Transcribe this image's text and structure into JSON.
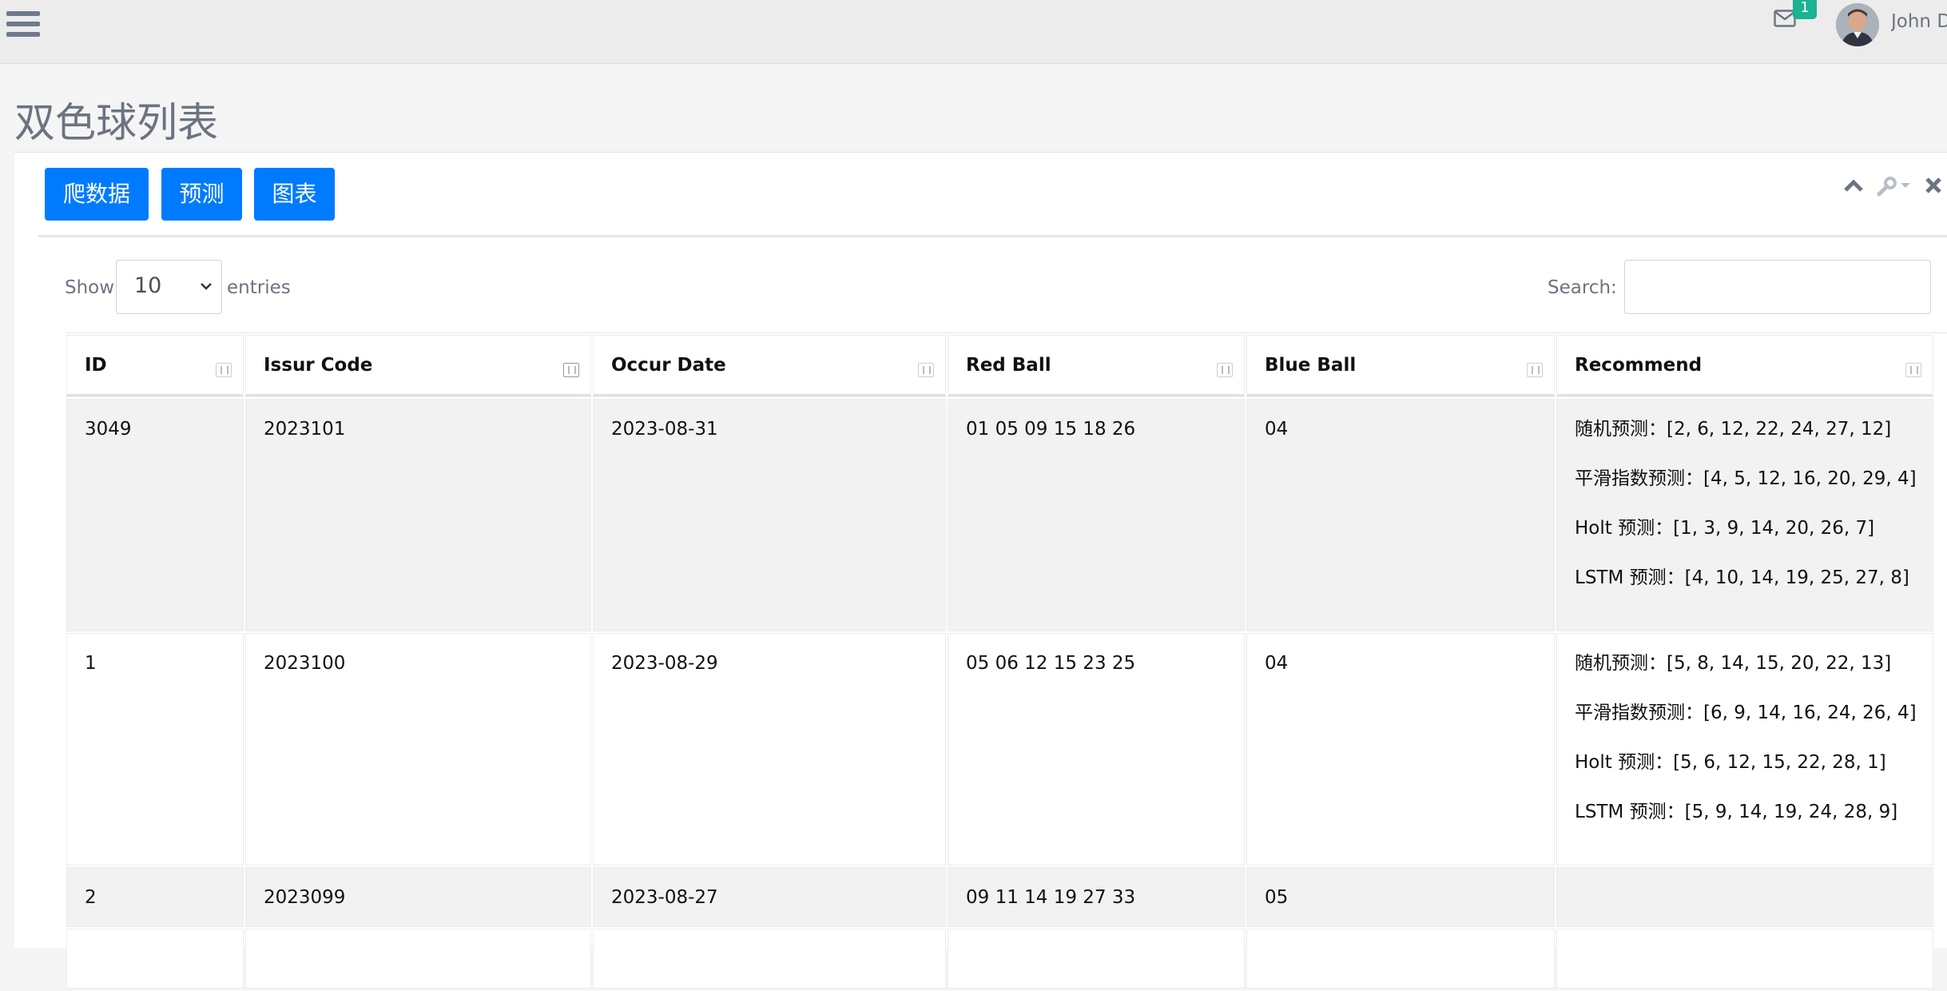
{
  "header": {
    "mail_badge": "1",
    "user_name": "John D"
  },
  "page": {
    "title": "双色球列表"
  },
  "toolbar": {
    "crawl_label": "爬数据",
    "predict_label": "预测",
    "chart_label": "图表"
  },
  "table_controls": {
    "show_label": "Show",
    "page_size": "10",
    "entries_label": "entries",
    "search_label": "Search:",
    "search_value": ""
  },
  "table": {
    "columns": [
      "ID",
      "Issur Code",
      "Occur Date",
      "Red Ball",
      "Blue Ball",
      "Recommend"
    ],
    "rows": [
      {
        "id": "3049",
        "issue_code": "2023101",
        "occur_date": "2023-08-31",
        "red_ball": "01 05 09 15 18 26",
        "blue_ball": "04",
        "recommend": [
          "随机预测：[2, 6, 12, 22, 24, 27, 12]",
          "平滑指数预测：[4, 5, 12, 16, 20, 29, 4]",
          "Holt 预测：[1, 3, 9, 14, 20, 26, 7]",
          "LSTM 预测：[4, 10, 14, 19, 25, 27, 8]"
        ]
      },
      {
        "id": "1",
        "issue_code": "2023100",
        "occur_date": "2023-08-29",
        "red_ball": "05 06 12 15 23 25",
        "blue_ball": "04",
        "recommend": [
          "随机预测：[5, 8, 14, 15, 20, 22, 13]",
          "平滑指数预测：[6, 9, 14, 16, 24, 26, 4]",
          "Holt 预测：[5, 6, 12, 15, 22, 28, 1]",
          "LSTM 预测：[5, 9, 14, 19, 24, 28, 9]"
        ]
      },
      {
        "id": "2",
        "issue_code": "2023099",
        "occur_date": "2023-08-27",
        "red_ball": "09 11 14 19 27 33",
        "blue_ball": "05",
        "recommend": []
      }
    ]
  }
}
